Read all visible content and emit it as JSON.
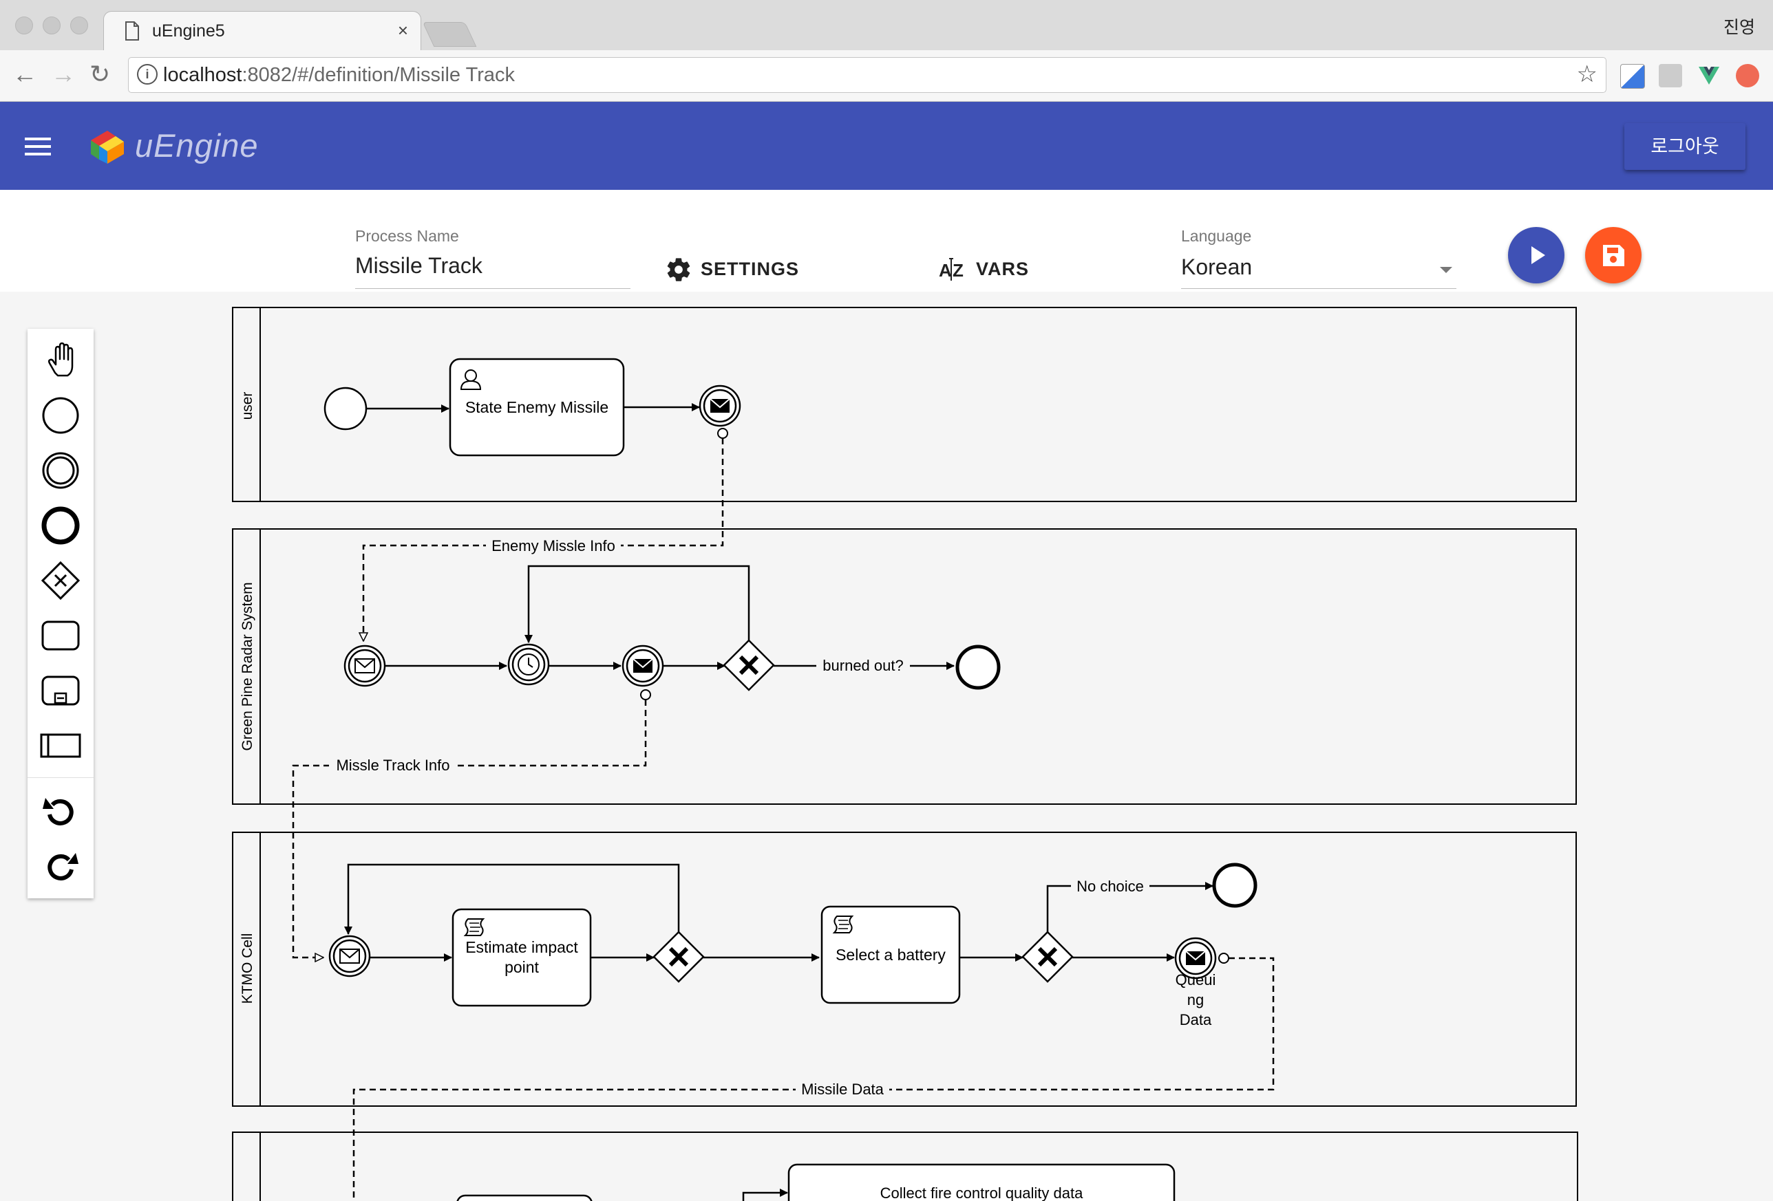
{
  "browser": {
    "tab_title": "uEngine5",
    "tab_close": "×",
    "profile_name": "진영",
    "url_host": "localhost",
    "url_rest": ":8082/#/definition/Missile Track"
  },
  "app": {
    "logo_text": "uEngine",
    "logout_label": "로그아웃"
  },
  "form": {
    "process_name_label": "Process Name",
    "process_name_value": "Missile Track",
    "settings_label": "SETTINGS",
    "vars_label": "VARS",
    "language_label": "Language",
    "language_value": "Korean"
  },
  "palette": [
    "hand-tool",
    "start-event",
    "intermediate-event",
    "end-event",
    "gateway",
    "task",
    "subprocess",
    "pool",
    "undo",
    "redo"
  ],
  "diagram": {
    "lanes": [
      "user",
      "Green Pine Radar System",
      "KTMO Cell"
    ],
    "tasks": {
      "state_enemy_missile": "State Enemy Missile",
      "estimate_impact_point_1": "Estimate impact",
      "estimate_impact_point_2": "point",
      "select_battery": "Select a battery",
      "collect_fire_control": "Collect fire control quality data"
    },
    "flow_labels": {
      "enemy_missle_info": "Enemy Missle Info",
      "missle_track_info": "Missle Track Info",
      "burned_out": "burned out?",
      "no_choice": "No choice",
      "missile_data": "Missile Data"
    },
    "event_labels": {
      "queuing_1": "Queui",
      "queuing_2": "ng",
      "queuing_3": "Data"
    }
  },
  "colors": {
    "appbar": "#3f51b5",
    "play_fab": "#3f51b5",
    "save_fab": "#ff5722"
  }
}
